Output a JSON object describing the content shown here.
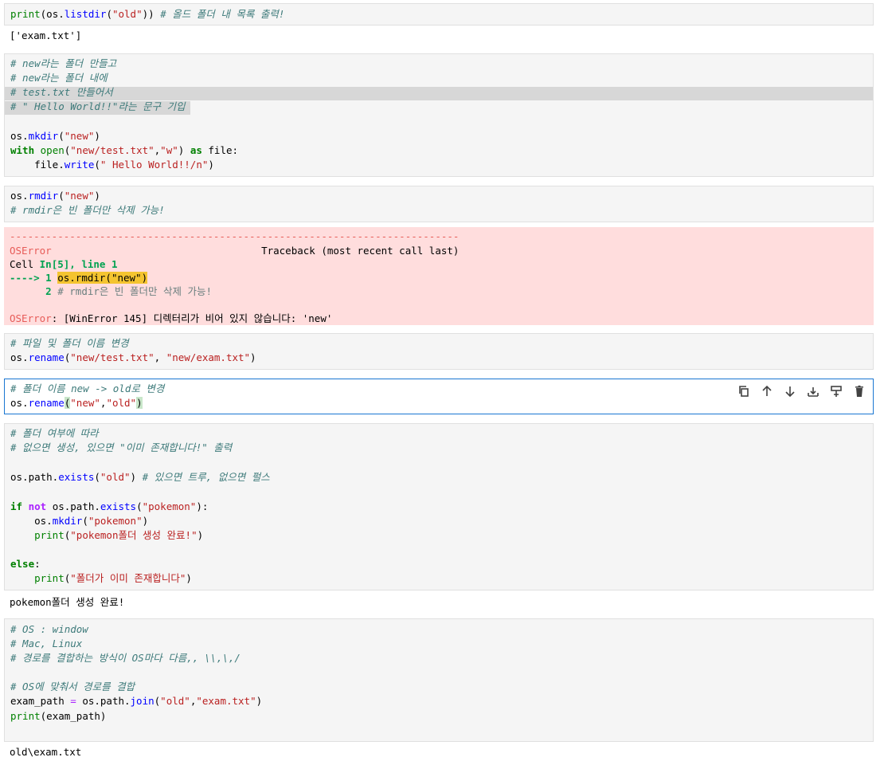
{
  "cells": {
    "c1": {
      "l1_a": "print",
      "l1_b": "(os.",
      "l1_c": "listdir",
      "l1_d": "(",
      "l1_e": "\"old\"",
      "l1_f": ")) ",
      "l1_g": "# 올드 폴더 내 목록 출력!"
    },
    "o1": "['exam.txt']",
    "c2": {
      "l1": "# new라는 폴더 만들고",
      "l2": "# new라는 폴더 내에",
      "l3": "# test.txt 만들어서",
      "l4": "# \" Hello World!!\"라는 문구 기입",
      "l6_a": "os.",
      "l6_b": "mkdir",
      "l6_c": "(",
      "l6_d": "\"new\"",
      "l6_e": ")",
      "l7_a": "with",
      "l7_b": " ",
      "l7_c": "open",
      "l7_d": "(",
      "l7_e": "\"new/test.txt\"",
      "l7_f": ",",
      "l7_g": "\"w\"",
      "l7_h": ") ",
      "l7_i": "as",
      "l7_j": " file:",
      "l8_a": "    file.",
      "l8_b": "write",
      "l8_c": "(",
      "l8_d": "\" Hello World!!/n\"",
      "l8_e": ")"
    },
    "c3": {
      "l1_a": "os.",
      "l1_b": "rmdir",
      "l1_c": "(",
      "l1_d": "\"new\"",
      "l1_e": ")",
      "l2": "# rmdir은 빈 폴더만 삭제 가능!"
    },
    "err": {
      "rule": "---------------------------------------------------------------------------",
      "l2_a": "OSError",
      "l2_b": "                                   Traceback (most recent call last)",
      "l3_a": "Cell ",
      "l3_b": "In[5], line 1",
      "l4_a": "----> 1 ",
      "l4_b": "os.rmdir(\"new\")",
      "l5_a": "      2 ",
      "l5_b": "# rmdir은 빈 폴더만 삭제 가능!",
      "l7_a": "OSError",
      "l7_b": ": [WinError 145] 디렉터리가 비어 있지 않습니다: 'new'"
    },
    "c4": {
      "l1": "# 파일 및 폴더 이름 변경",
      "l2_a": "os.",
      "l2_b": "rename",
      "l2_c": "(",
      "l2_d": "\"new/test.txt\"",
      "l2_e": ", ",
      "l2_f": "\"new/exam.txt\"",
      "l2_g": ")"
    },
    "c5": {
      "l1": "# 폴더 이름 new -> old로 변경",
      "l2_a": "os.",
      "l2_b": "rename",
      "l2_c": "(",
      "l2_d": "\"new\"",
      "l2_e": ",",
      "l2_f": "\"old\"",
      "l2_g": ")"
    },
    "c6": {
      "l1": "# 폴더 여부에 따라",
      "l2": "# 없으면 생성, 있으면 \"이미 존재합니다!\" 출력",
      "l4_a": "os.path.",
      "l4_b": "exists",
      "l4_c": "(",
      "l4_d": "\"old\"",
      "l4_e": ") ",
      "l4_f": "# 있으면 트루, 없으면 펄스",
      "l6_a": "if",
      "l6_b": " ",
      "l6_c": "not",
      "l6_d": " os.path.",
      "l6_e": "exists",
      "l6_f": "(",
      "l6_g": "\"pokemon\"",
      "l6_h": "):",
      "l7_a": "    os.",
      "l7_b": "mkdir",
      "l7_c": "(",
      "l7_d": "\"pokemon\"",
      "l7_e": ")",
      "l8_a": "    ",
      "l8_b": "print",
      "l8_c": "(",
      "l8_d": "\"pokemon폴더 생성 완료!\"",
      "l8_e": ")",
      "l10": "else",
      "l10_b": ":",
      "l11_a": "    ",
      "l11_b": "print",
      "l11_c": "(",
      "l11_d": "\"폴더가 이미 존재합니다\"",
      "l11_e": ")"
    },
    "o6": "pokemon폴더 생성 완료!",
    "c7": {
      "l1": "# OS : window",
      "l2": "# Mac, Linux",
      "l3": "# 경로를 결합하는 방식이 OS마다 다름,, \\\\,\\,/",
      "l5": "# OS에 맞춰서 경로를 결합",
      "l6_a": "exam_path ",
      "l6_b": "=",
      "l6_c": " os.path.",
      "l6_d": "join",
      "l6_e": "(",
      "l6_f": "\"old\"",
      "l6_g": ",",
      "l6_h": "\"exam.txt\"",
      "l6_i": ")",
      "l7_a": "print",
      "l7_b": "(exam_path)"
    },
    "o7": "old\\exam.txt"
  },
  "toolbar": {
    "icons": [
      "duplicate-icon",
      "move-up-icon",
      "move-down-icon",
      "insert-below-icon",
      "insert-above-icon",
      "delete-icon"
    ]
  },
  "colors": {
    "active_border": "#1976d2",
    "error_bg": "#ffdddd",
    "comment": "#3d7a7a",
    "keyword": "#008000",
    "string": "#ba2121"
  }
}
